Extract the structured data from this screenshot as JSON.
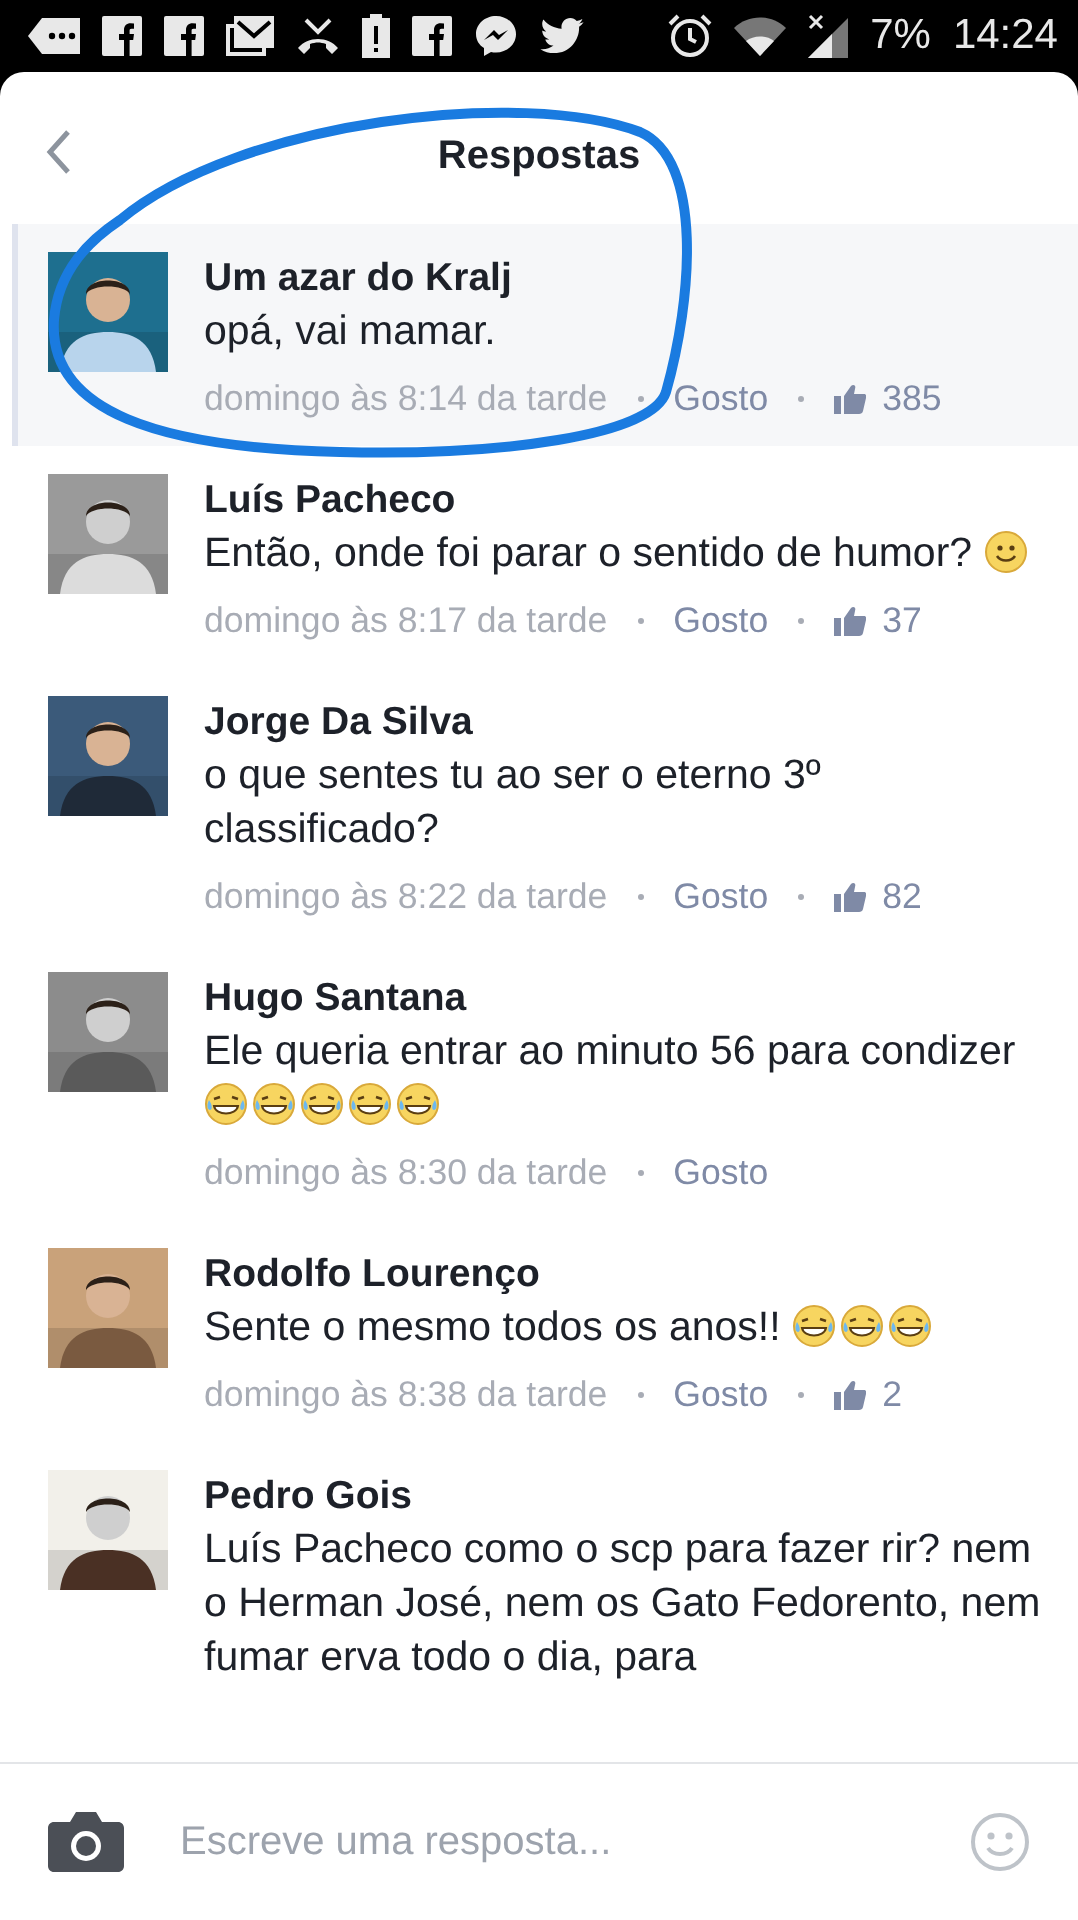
{
  "status_bar": {
    "notifications": [
      {
        "kind": "more"
      },
      {
        "kind": "facebook"
      },
      {
        "kind": "facebook"
      },
      {
        "kind": "mail"
      },
      {
        "kind": "missed-call"
      },
      {
        "kind": "battery-alert"
      },
      {
        "kind": "facebook"
      },
      {
        "kind": "messenger"
      },
      {
        "kind": "bird"
      }
    ],
    "system": [
      {
        "kind": "alarm"
      },
      {
        "kind": "wifi"
      },
      {
        "kind": "signal"
      }
    ],
    "battery": "7%",
    "time": "14:24"
  },
  "header": {
    "title": "Respostas"
  },
  "comments": [
    {
      "name": "Um azar do Kralj",
      "text": "opá, vai mamar.",
      "time": "domingo às 8:14 da tarde",
      "like": "Gosto",
      "likes": "385",
      "highlighted": true
    },
    {
      "name": "Luís Pacheco",
      "text": "Então, onde foi parar o sentido de humor?",
      "emojis": [
        {
          "kind": "smile"
        }
      ],
      "time": "domingo às 8:17 da tarde",
      "like": "Gosto",
      "likes": "37",
      "highlighted": false
    },
    {
      "name": "Jorge Da Silva",
      "text": "o que sentes tu ao ser o eterno 3º classificado?",
      "time": "domingo às 8:22 da tarde",
      "like": "Gosto",
      "likes": "82",
      "highlighted": false
    },
    {
      "name": "Hugo Santana",
      "text": "Ele queria entrar ao minuto 56 para condizer",
      "emojis": [
        {
          "kind": "laugh"
        },
        {
          "kind": "laugh"
        },
        {
          "kind": "laugh"
        },
        {
          "kind": "laugh"
        },
        {
          "kind": "laugh"
        }
      ],
      "time": "domingo às 8:30 da tarde",
      "like": "Gosto",
      "highlighted": false
    },
    {
      "name": "Rodolfo Lourenço",
      "text": "Sente o mesmo todos os anos!!",
      "emojis": [
        {
          "kind": "laugh"
        },
        {
          "kind": "laugh"
        },
        {
          "kind": "laugh"
        }
      ],
      "time": "domingo às 8:38 da tarde",
      "like": "Gosto",
      "likes": "2",
      "highlighted": false
    },
    {
      "name": "Pedro Gois",
      "text": "Luís Pacheco como o scp para fazer rir? nem o Herman José, nem os Gato Fedorento, nem fumar erva todo o dia, para",
      "highlighted": false
    }
  ],
  "annotation": {
    "kind": "ellipse",
    "color": "#1a7be0"
  },
  "composer": {
    "placeholder": "Escreve uma resposta..."
  }
}
